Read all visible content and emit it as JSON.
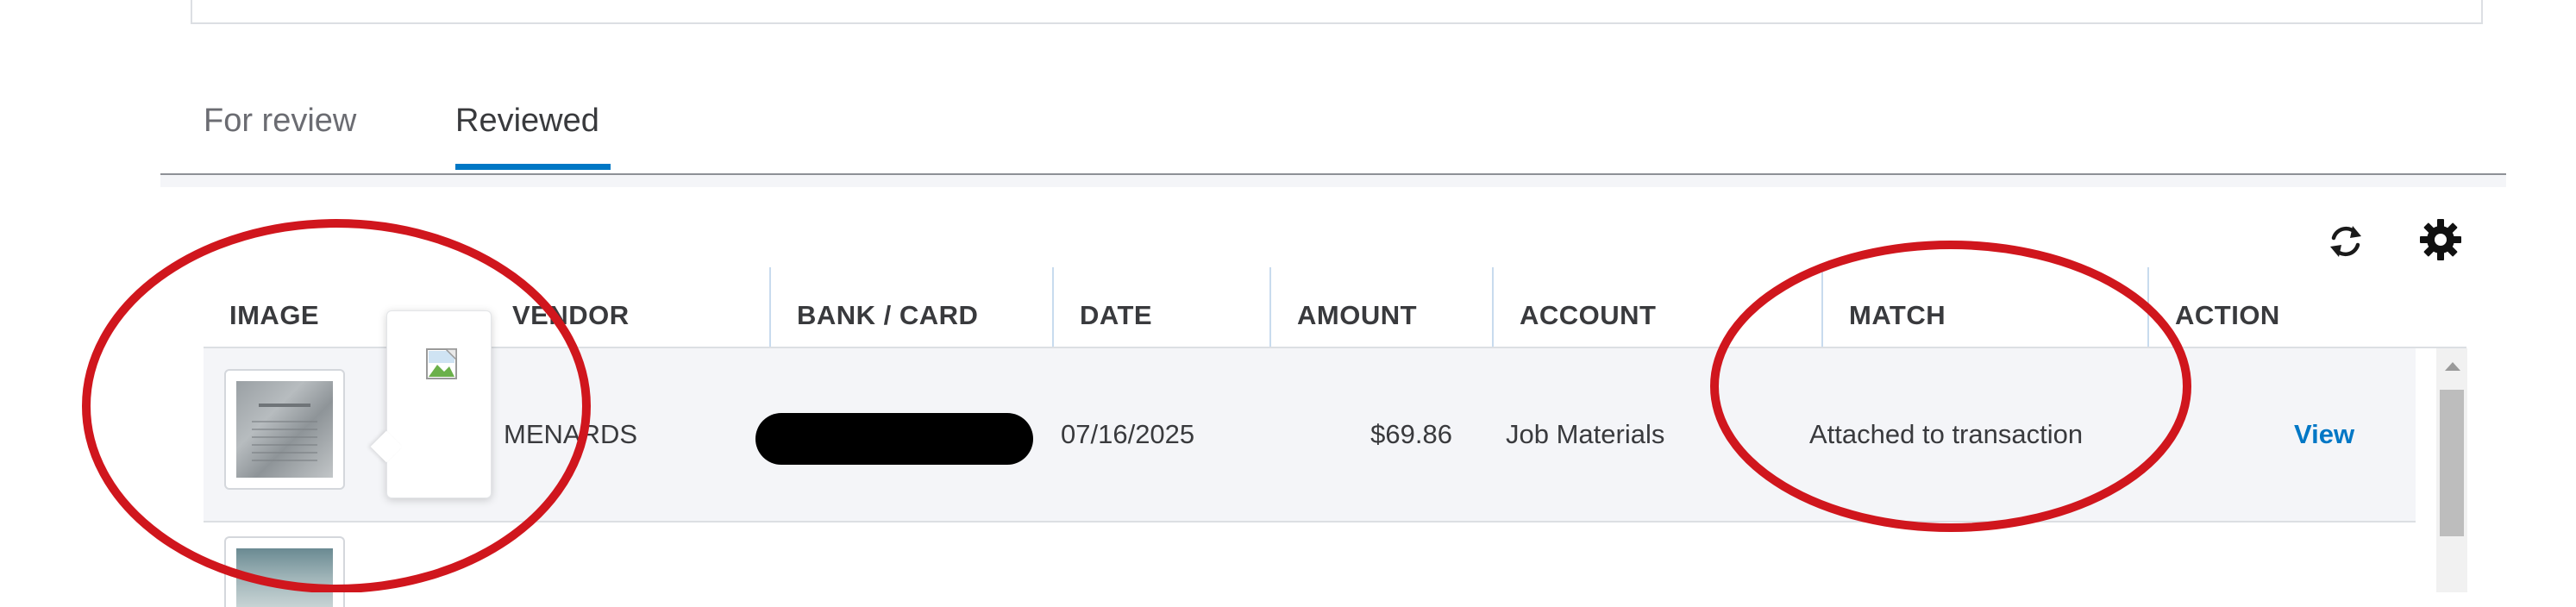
{
  "tabs": [
    {
      "label": "For review",
      "active": false
    },
    {
      "label": "Reviewed",
      "active": true
    }
  ],
  "toolbar": {
    "refresh_icon": "refresh-icon",
    "settings_icon": "gear-icon"
  },
  "table": {
    "columns": [
      "IMAGE",
      "VENDOR",
      "BANK / CARD",
      "DATE",
      "AMOUNT",
      "ACCOUNT",
      "MATCH",
      "ACTION"
    ],
    "rows": [
      {
        "vendor": "MENARDS",
        "bank_card": "",
        "date": "07/16/2025",
        "amount": "$69.86",
        "account": "Job Materials",
        "match": "Attached to transaction",
        "action": "View"
      }
    ]
  },
  "colors": {
    "accent": "#0077c5",
    "annotation": "#d0161d",
    "row_background": "#f4f5f8"
  }
}
